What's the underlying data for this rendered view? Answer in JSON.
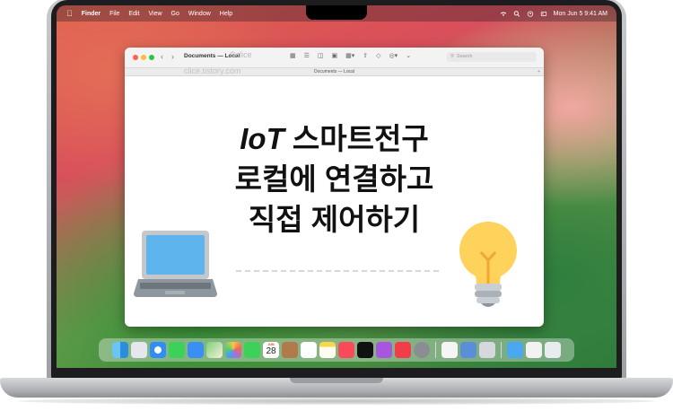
{
  "menubar": {
    "app": "Finder",
    "menus": [
      "File",
      "Edit",
      "View",
      "Go",
      "Window",
      "Help"
    ],
    "clock": "Mon Jun 5  9:41 AM"
  },
  "window": {
    "title": "Documents — Local",
    "watermark": "©clice",
    "tab_title": "Documents — Local",
    "search_placeholder": "Search",
    "sub_watermark": "clice.tistory.com"
  },
  "headline": {
    "line1_em": "IoT",
    "line1_rest": " 스마트전구",
    "line2": "로컬에 연결하고",
    "line3": "직접 제어하기"
  },
  "dock": {
    "calendar_month": "JUN",
    "calendar_day": "28",
    "apps": [
      "finder",
      "launchpad",
      "safari",
      "messages",
      "mail",
      "maps",
      "photos",
      "facetime",
      "calendar",
      "contacts-book",
      "reminders",
      "notes",
      "music",
      "tv",
      "podcasts",
      "news",
      "settings",
      "pages",
      "keynote",
      "numbers",
      "folder",
      "documents",
      "trash"
    ]
  },
  "colors": {
    "traffic_red": "#ff5f57",
    "traffic_yellow": "#febc2e",
    "traffic_green": "#28c840",
    "laptop_screen": "#5eb5ee",
    "bulb": "#ffd25c"
  }
}
